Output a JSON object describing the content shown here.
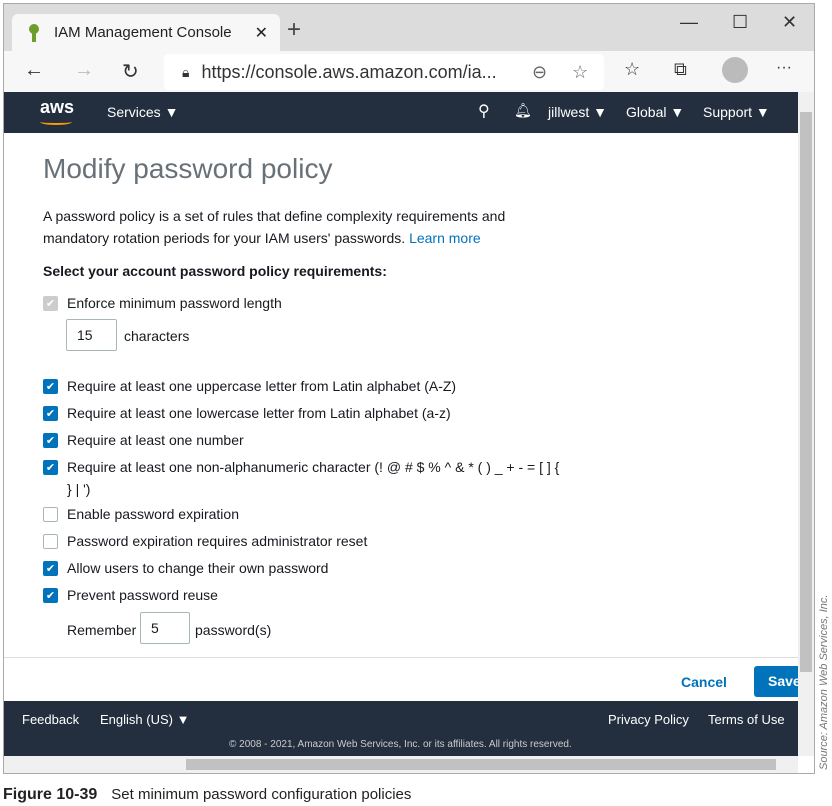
{
  "browser": {
    "tab_title": "IAM Management Console",
    "url": "https://console.aws.amazon.com/ia..."
  },
  "nav": {
    "logo": "aws",
    "services": "Services ▼",
    "user": "jillwest ▼",
    "region": "Global ▼",
    "support": "Support ▼"
  },
  "page": {
    "title": "Modify password policy",
    "description": "A password policy is a set of rules that define complexity requirements and mandatory rotation periods for your IAM users' passwords.",
    "learn_more": "Learn more",
    "subheading": "Select your account password policy requirements:"
  },
  "options": [
    {
      "label": "Enforce minimum password length",
      "checked": true,
      "disabled": true
    },
    {
      "label": "Require at least one uppercase letter from Latin alphabet (A-Z)",
      "checked": true
    },
    {
      "label": "Require at least one lowercase letter from Latin alphabet (a-z)",
      "checked": true
    },
    {
      "label": "Require at least one number",
      "checked": true
    },
    {
      "label": "Require at least one non-alphanumeric character (! @ # $ % ^ & * ( ) _ + - = [ ] { } | ')",
      "checked": true
    },
    {
      "label": "Enable password expiration",
      "checked": false
    },
    {
      "label": "Password expiration requires administrator reset",
      "checked": false
    },
    {
      "label": "Allow users to change their own password",
      "checked": true
    },
    {
      "label": "Prevent password reuse",
      "checked": true
    }
  ],
  "min_length": {
    "value": "15",
    "unit": "characters"
  },
  "reuse": {
    "prefix": "Remember",
    "value": "5",
    "unit": "password(s)"
  },
  "actions": {
    "cancel": "Cancel",
    "save": "Save"
  },
  "footer": {
    "feedback": "Feedback",
    "language": "English (US) ▼",
    "privacy": "Privacy Policy",
    "terms": "Terms of Use",
    "copyright": "© 2008 - 2021, Amazon Web Services, Inc. or its affiliates. All rights reserved."
  },
  "source": "Source: Amazon Web Services, Inc.",
  "caption": {
    "figure": "Figure 10-39",
    "text": "Set minimum password configuration policies"
  }
}
